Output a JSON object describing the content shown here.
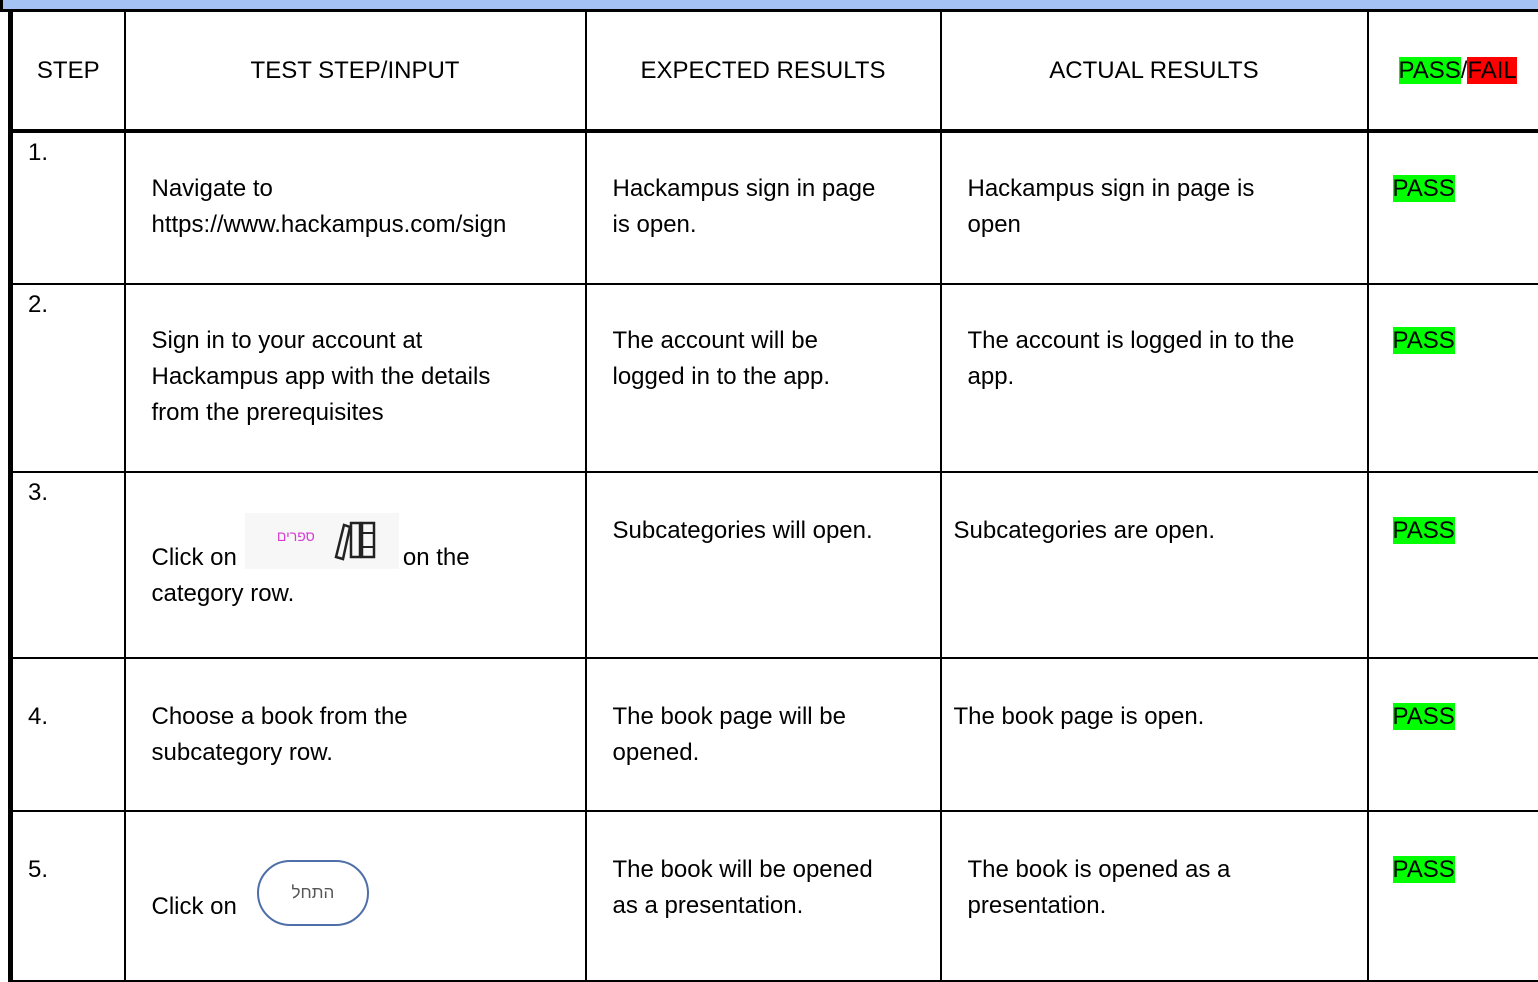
{
  "headers": {
    "step": "STEP",
    "input": "TEST STEP/INPUT",
    "expected": "EXPECTED RESULTS",
    "actual": "ACTUAL RESULTS",
    "pass": "PASS",
    "slash": "/",
    "fail": "FAIL"
  },
  "rows": [
    {
      "step": "1.",
      "input": [
        "Navigate to",
        "https://www.hackampus.com/sign"
      ],
      "expected": [
        "Hackampus sign in page",
        "is open."
      ],
      "actual": [
        "Hackampus sign in page is",
        "open"
      ],
      "result": "PASS"
    },
    {
      "step": "2.",
      "input": [
        "Sign in to your account at",
        "Hackampus app with the details",
        "from the prerequisites"
      ],
      "expected": [
        "The account will be",
        "logged in to the app."
      ],
      "actual": [
        "The account is logged in to the",
        "app."
      ],
      "result": "PASS"
    },
    {
      "step": "3.",
      "input_before": "Click on",
      "input_after": "on the",
      "input_line2": "category row.",
      "books_button_label": "ספרים",
      "expected": "Subcategories will open.",
      "actual": "Subcategories are open.",
      "result": "PASS"
    },
    {
      "step": "4.",
      "input": [
        "Choose a book from the",
        "subcategory row."
      ],
      "expected": [
        "The book page will be",
        "opened."
      ],
      "actual": "The book page is open.",
      "result": "PASS"
    },
    {
      "step": "5.",
      "input_before": "Click on",
      "start_button_label": "התחל",
      "expected": [
        "The book will be opened",
        "as a presentation."
      ],
      "actual": [
        "The book is opened as a",
        "presentation."
      ],
      "result": "PASS"
    }
  ]
}
